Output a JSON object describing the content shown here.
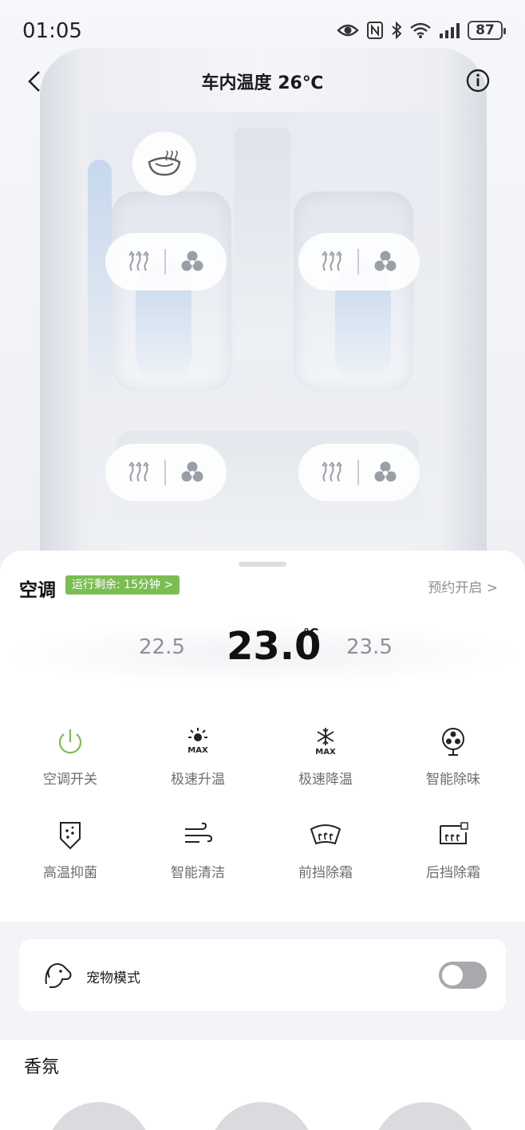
{
  "status_bar": {
    "time": "01:05",
    "battery": "87",
    "icons": [
      "eye-icon",
      "nfc-icon",
      "bluetooth-icon",
      "wifi-icon",
      "signal-icon",
      "battery-icon"
    ]
  },
  "header": {
    "title": "车内温度 26℃",
    "back_icon": "chevron-left-icon",
    "info_icon": "info-icon"
  },
  "car_view": {
    "steering_heat_icon": "steering-wheel-heat-icon",
    "seats": [
      {
        "position": "front-left",
        "heat_icon": "seat-heat-icon",
        "fan_icon": "fan-icon"
      },
      {
        "position": "front-right",
        "heat_icon": "seat-heat-icon",
        "fan_icon": "fan-icon"
      },
      {
        "position": "rear-left",
        "heat_icon": "seat-heat-icon",
        "fan_icon": "fan-icon"
      },
      {
        "position": "rear-right",
        "heat_icon": "seat-heat-icon",
        "fan_icon": "fan-icon"
      }
    ]
  },
  "ac": {
    "label": "空调",
    "run_badge": "运行剩余: 15分钟 >",
    "schedule": "预约开启 >",
    "temp_lower": "22.5",
    "temp_current": "23.0",
    "temp_unit": "℃",
    "temp_higher": "23.5",
    "accent_color": "#7cbd53",
    "functions": [
      {
        "label": "空调开关",
        "icon": "power-icon"
      },
      {
        "label": "极速升温",
        "icon": "sun-max-icon"
      },
      {
        "label": "极速降温",
        "icon": "snowflake-max-icon"
      },
      {
        "label": "智能除味",
        "icon": "fan-deodorize-icon"
      },
      {
        "label": "高温抑菌",
        "icon": "shield-bacteria-icon"
      },
      {
        "label": "智能清洁",
        "icon": "wind-clean-icon"
      },
      {
        "label": "前挡除霜",
        "icon": "front-defrost-icon"
      },
      {
        "label": "后挡除霜",
        "icon": "rear-defrost-icon"
      }
    ]
  },
  "pet_mode": {
    "label": "宠物模式",
    "icon": "dog-icon",
    "enabled": false
  },
  "fragrance": {
    "title": "香氛"
  }
}
